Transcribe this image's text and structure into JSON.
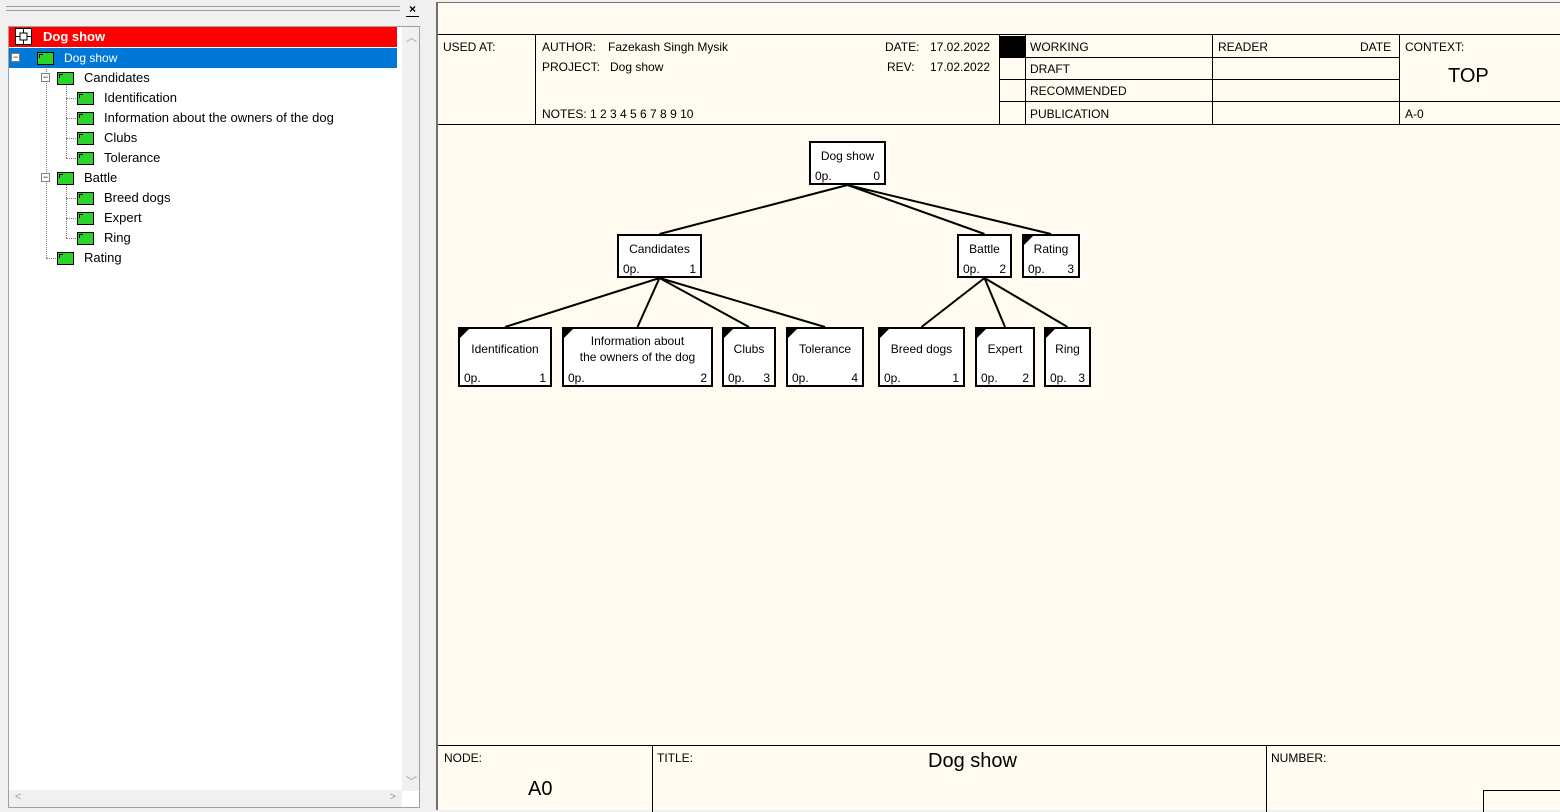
{
  "tree": {
    "close_label": "×",
    "root_label": "Dog show",
    "items": [
      {
        "label": "Dog show",
        "selected": true
      },
      {
        "label": "Candidates"
      },
      {
        "label": "Identification"
      },
      {
        "label": "Information about  the owners of the dog"
      },
      {
        "label": "Clubs"
      },
      {
        "label": "Tolerance"
      },
      {
        "label": "Battle"
      },
      {
        "label": "Breed dogs"
      },
      {
        "label": "Expert"
      },
      {
        "label": "Ring"
      },
      {
        "label": "Rating"
      }
    ],
    "colors": {
      "root_bg": "#ff0000",
      "selected_bg": "#0078d7",
      "node_fill": "#2ad42a"
    }
  },
  "header": {
    "used_at": "USED AT:",
    "author_label": "AUTHOR:",
    "author": "Fazekash Singh Mysik",
    "project_label": "PROJECT:",
    "project": "Dog show",
    "date_label": "DATE:",
    "date": "17.02.2022",
    "rev_label": "REV:",
    "rev": "17.02.2022",
    "notes": "NOTES:  1  2  3  4  5  6  7  8  9  10",
    "status": [
      "WORKING",
      "DRAFT",
      "RECOMMENDED",
      "PUBLICATION"
    ],
    "reader": "READER",
    "reader_date": "DATE",
    "context_label": "CONTEXT:",
    "context": "TOP",
    "context_node": "A-0"
  },
  "footer": {
    "node_label": "NODE:",
    "node": "A0",
    "title_label": "TITLE:",
    "title": "Dog show",
    "number_label": "NUMBER:"
  },
  "diagram": {
    "nodes": [
      {
        "id": "n0",
        "title": "Dog show",
        "cost": "0p.",
        "num": "0"
      },
      {
        "id": "n1",
        "title": "Candidates",
        "cost": "0p.",
        "num": "1"
      },
      {
        "id": "n2",
        "title": "Battle",
        "cost": "0p.",
        "num": "2"
      },
      {
        "id": "n3",
        "title": "Rating",
        "cost": "0p.",
        "num": "3"
      },
      {
        "id": "n11",
        "title": "Identification",
        "cost": "0p.",
        "num": "1"
      },
      {
        "id": "n12",
        "title": "Information about\nthe owners of the dog",
        "cost": "0p.",
        "num": "2"
      },
      {
        "id": "n13",
        "title": "Clubs",
        "cost": "0p.",
        "num": "3"
      },
      {
        "id": "n14",
        "title": "Tolerance",
        "cost": "0p.",
        "num": "4"
      },
      {
        "id": "n21",
        "title": "Breed dogs",
        "cost": "0p.",
        "num": "1"
      },
      {
        "id": "n22",
        "title": "Expert",
        "cost": "0p.",
        "num": "2"
      },
      {
        "id": "n23",
        "title": "Ring",
        "cost": "0p.",
        "num": "3"
      }
    ],
    "edges": [
      [
        "n0",
        "n1"
      ],
      [
        "n0",
        "n2"
      ],
      [
        "n0",
        "n3"
      ],
      [
        "n1",
        "n11"
      ],
      [
        "n1",
        "n12"
      ],
      [
        "n1",
        "n13"
      ],
      [
        "n1",
        "n14"
      ],
      [
        "n2",
        "n21"
      ],
      [
        "n2",
        "n22"
      ],
      [
        "n2",
        "n23"
      ]
    ]
  }
}
